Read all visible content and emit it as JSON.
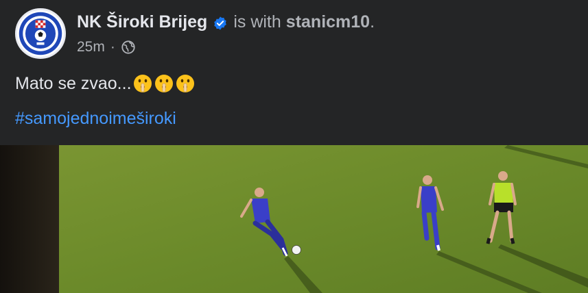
{
  "post": {
    "page_name": "NK Široki Brijeg",
    "with_text": "is with",
    "tagged_user": "stanicm10",
    "period": ".",
    "time": "25m",
    "dot": "·",
    "audience_icon": "globe-icon",
    "verified_icon": "verified-badge-icon",
    "text": "Mato se zvao...",
    "emoji_icon": "shushing-face-emoji",
    "emoji_count": 3,
    "hashtag": "#samojednoimeširoki"
  },
  "colors": {
    "background": "#242526",
    "primary_text": "#e4e6eb",
    "secondary_text": "#b0b3b8",
    "link": "#4599ff",
    "verified": "#1877f2",
    "pitch": "#6f8a2b",
    "kit": "#3a3fc8",
    "referee": "#b8e02a"
  },
  "media": {
    "type": "video",
    "icon": "video-frame"
  }
}
